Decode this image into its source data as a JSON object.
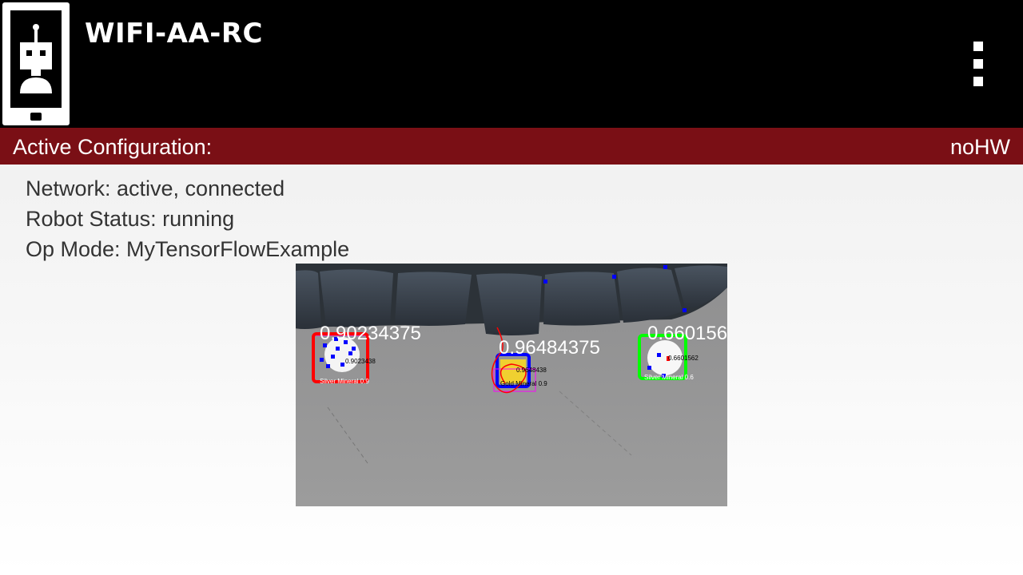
{
  "header": {
    "title": "WIFI-AA-RC",
    "icons": {
      "app": "robot-phone-icon",
      "menu": "overflow-menu-icon"
    }
  },
  "config_bar": {
    "label": "Active Configuration:",
    "value": "noHW",
    "color": "#7a0f15"
  },
  "status": {
    "network": "Network: active, connected",
    "robot": "Robot Status: running",
    "opmode": "Op Mode: MyTensorFlowExample"
  },
  "camera": {
    "detections": [
      {
        "confidence": "0.90234375",
        "label": "Silver Mineral 0.9",
        "sublabel": "0.9023438",
        "box_color": "#ff0000"
      },
      {
        "confidence": "0.96484375",
        "label": "Gold Mineral 0.9",
        "sublabel": "0.9648438",
        "box_color": "#0000ff"
      },
      {
        "confidence": "0.660156",
        "label": "Silver Mineral 0.6",
        "sublabel": "0.6601562",
        "box_color": "#00ff00"
      }
    ]
  }
}
